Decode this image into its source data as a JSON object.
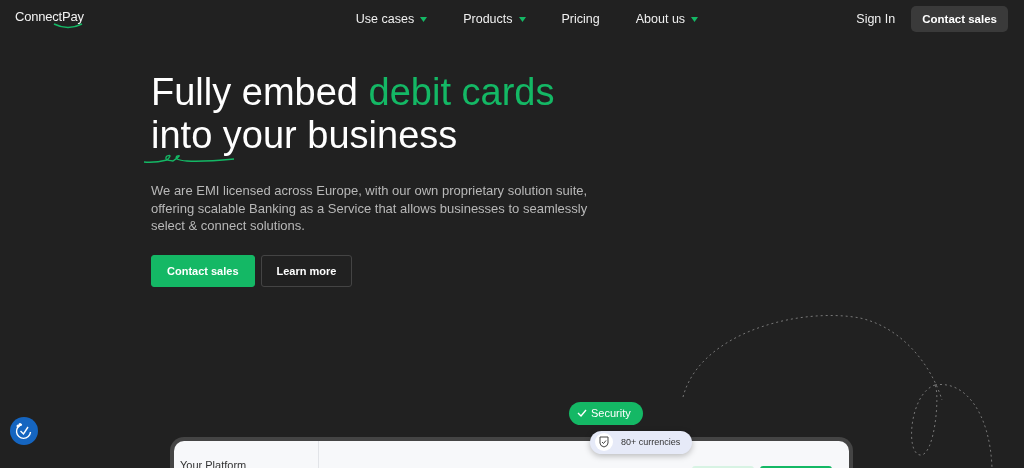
{
  "brand": {
    "name": "ConnectPay"
  },
  "nav": {
    "items": [
      {
        "label": "Use cases",
        "dropdown": true
      },
      {
        "label": "Products",
        "dropdown": true
      },
      {
        "label": "Pricing",
        "dropdown": false
      },
      {
        "label": "About us",
        "dropdown": true
      }
    ],
    "sign_in": "Sign In",
    "cta": "Contact sales"
  },
  "hero": {
    "title_start": "Fully embed",
    "title_highlight": "debit cards",
    "title_end": "into your business",
    "description": "We are EMI licensed across Europe, with our own proprietary solution suite, offering scalable Banking as a Service that allows businesses to seamlessly select & connect solutions.",
    "buttons": [
      {
        "label": "Contact sales",
        "kind": "primary"
      },
      {
        "label": "Learn more",
        "kind": "outline"
      }
    ]
  },
  "badges": {
    "security": "Security",
    "currencies": "80+ currencies"
  },
  "preview": {
    "title": "Your Platform"
  }
}
